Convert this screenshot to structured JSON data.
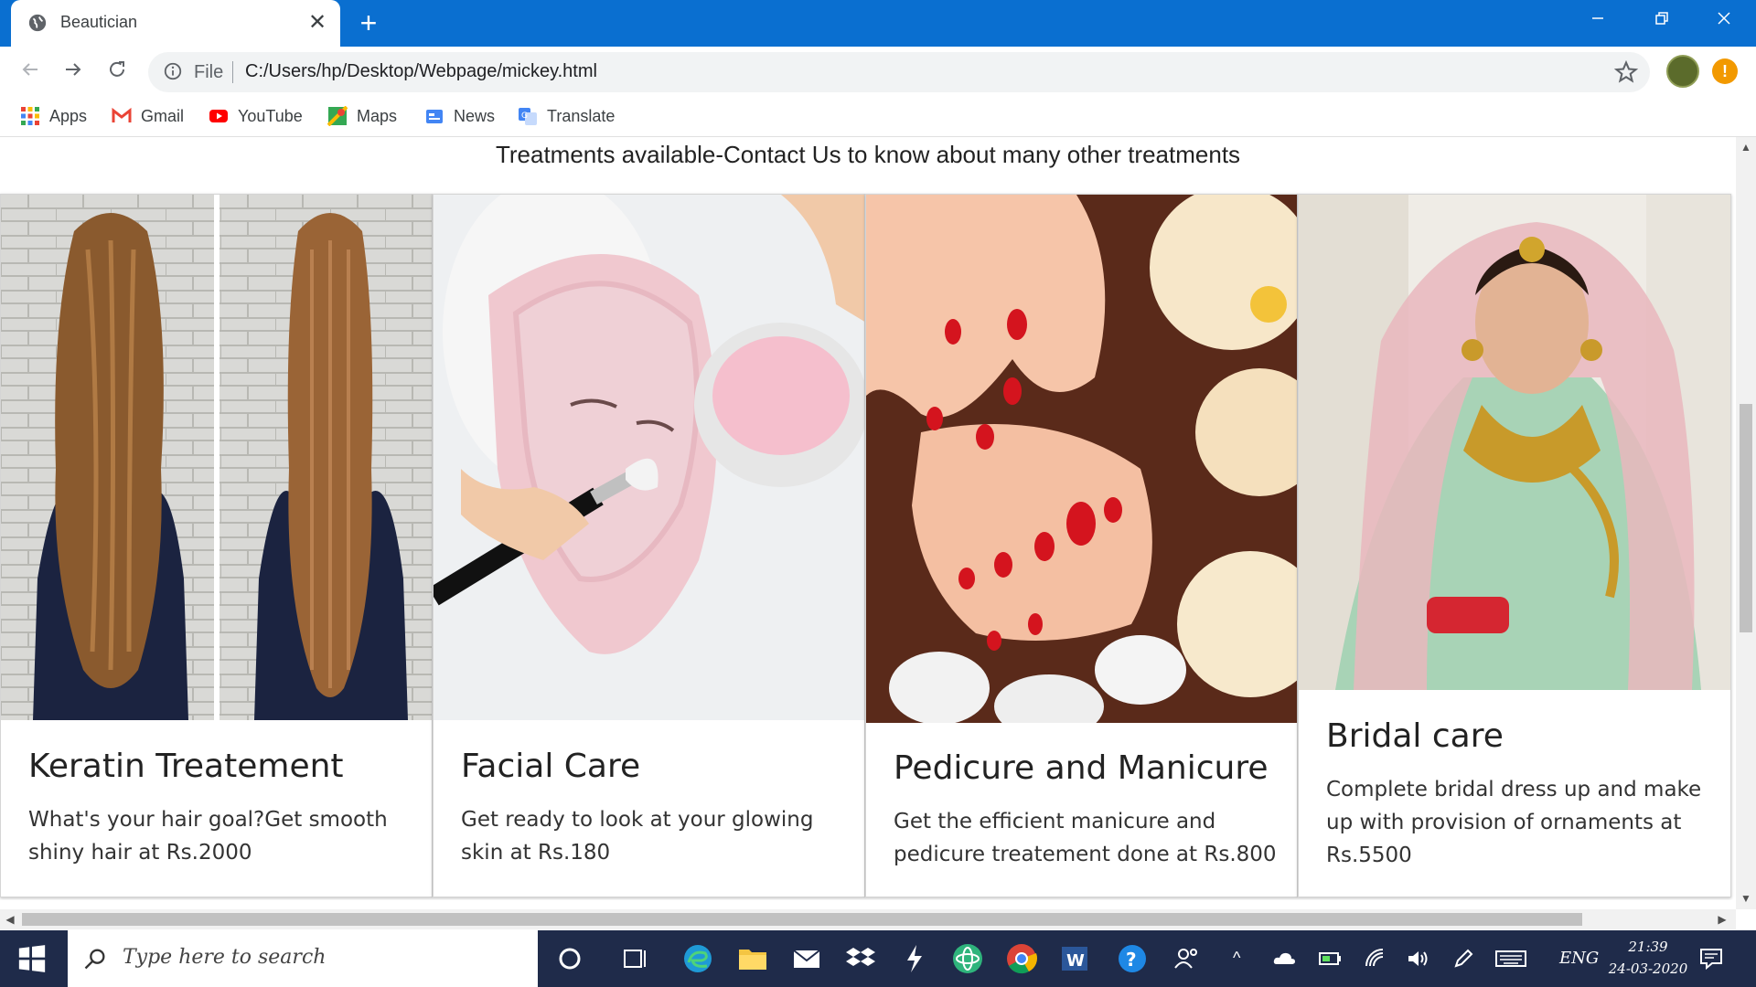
{
  "browser": {
    "tab_title": "Beautician",
    "close_tab": "✕",
    "new_tab": "+",
    "address_scheme": "File",
    "url": "C:/Users/hp/Desktop/Webpage/mickey.html",
    "update_badge": "!"
  },
  "bookmarks": [
    {
      "label": "Apps",
      "icon": "apps-grid-icon",
      "color": "#ea4335"
    },
    {
      "label": "Gmail",
      "icon": "gmail-icon",
      "color": "#ea4335"
    },
    {
      "label": "YouTube",
      "icon": "youtube-icon",
      "color": "#ff0000"
    },
    {
      "label": "Maps",
      "icon": "maps-icon",
      "color": "#34a853"
    },
    {
      "label": "News",
      "icon": "news-icon",
      "color": "#4285f4"
    },
    {
      "label": "Translate",
      "icon": "translate-icon",
      "color": "#4285f4"
    }
  ],
  "page": {
    "heading": "Treatments available-Contact Us to know about many other treatments",
    "cards": [
      {
        "title": "Keratin Treatement",
        "text": "What's your hair goal?Get smooth shiny hair at Rs.2000",
        "image": "keratin-hair-image"
      },
      {
        "title": "Facial Care",
        "text": "Get ready to look at your glowing skin at Rs.180",
        "image": "facial-mask-image"
      },
      {
        "title": "Pedicure and Manicure",
        "text": "Get the efficient manicure and pedicure treatement done at Rs.800",
        "image": "manicure-pedicure-image"
      },
      {
        "title": "Bridal care",
        "text": "Complete bridal dress up and make up with provision of ornaments at Rs.5500",
        "image": "bridal-image"
      }
    ]
  },
  "taskbar": {
    "search_placeholder": "Type here to search",
    "language": "ENG",
    "time": "21:39",
    "date": "24-03-2020"
  },
  "colors": {
    "tabstrip": "#0a6fd0",
    "taskbar": "#1f2b4a"
  }
}
